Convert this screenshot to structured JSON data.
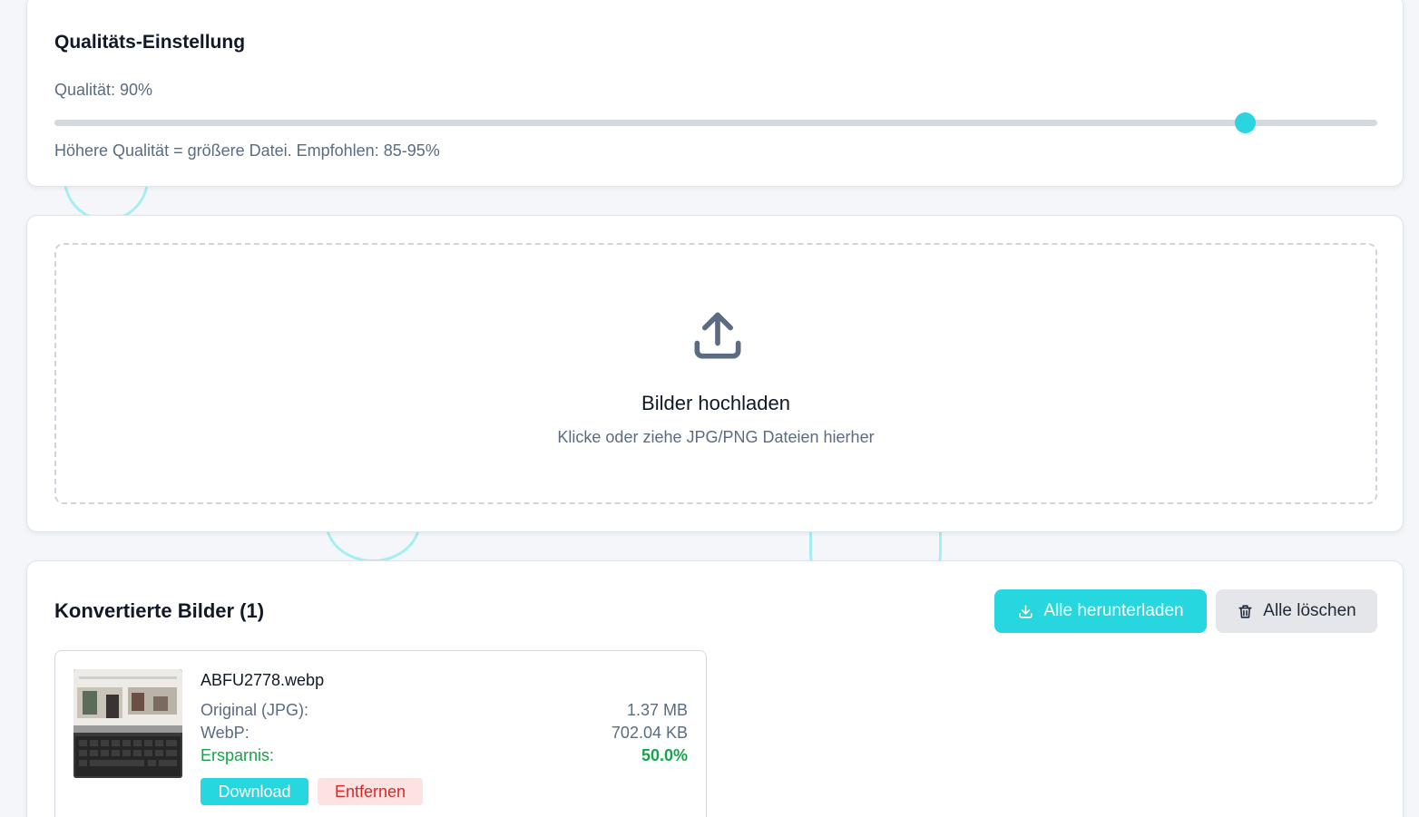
{
  "quality": {
    "title": "Qualitäts-Einstellung",
    "value_label": "Qualität: 90%",
    "value_percent": 90,
    "hint": "Höhere Qualität = größere Datei. Empfohlen: 85-95%"
  },
  "upload": {
    "icon": "upload-icon",
    "title": "Bilder hochladen",
    "subtitle": "Klicke oder ziehe JPG/PNG Dateien hierher"
  },
  "converted": {
    "title": "Konvertierte Bilder (1)",
    "download_all_label": "Alle herunterladen",
    "clear_all_label": "Alle löschen",
    "items": [
      {
        "name": "ABFU2778.webp",
        "original_label": "Original (JPG):",
        "original_value": "1.37 MB",
        "webp_label": "WebP:",
        "webp_value": "702.04 KB",
        "savings_label": "Ersparnis:",
        "savings_value": "50.0%",
        "download_label": "Download",
        "remove_label": "Entfernen"
      }
    ]
  },
  "colors": {
    "accent": "#26d7df",
    "savings": "#16a34a",
    "danger": "#dc2626",
    "danger_bg": "#fde2e2"
  }
}
